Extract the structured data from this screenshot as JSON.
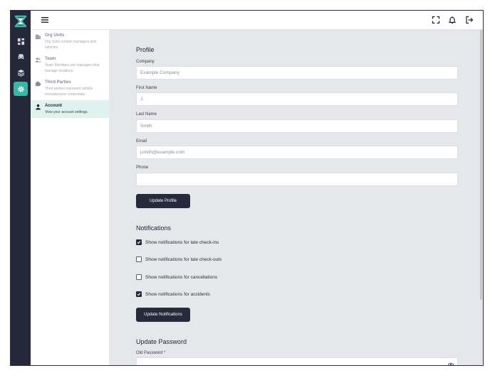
{
  "topbar": {
    "menu_icon": "hamburger-icon",
    "actions": [
      {
        "name": "fullscreen-icon"
      },
      {
        "name": "bell-icon"
      },
      {
        "name": "logout-icon"
      }
    ]
  },
  "rail": {
    "logo_icon": "app-logo-icon",
    "items": [
      {
        "name": "dashboard-icon",
        "active": false
      },
      {
        "name": "car-icon",
        "active": false
      },
      {
        "name": "layers-icon",
        "active": false
      },
      {
        "name": "gear-icon",
        "active": true
      }
    ]
  },
  "settings_nav": {
    "items": [
      {
        "title": "Org Units",
        "desc": "Org Units contain managers and vehicles.",
        "icon": "building-icon",
        "active": false
      },
      {
        "title": "Team",
        "desc": "Team Members are managers that manage locations.",
        "icon": "team-icon",
        "active": false
      },
      {
        "title": "Third Parties",
        "desc": "Third parties represent vehicle manufactures credentials.",
        "icon": "puzzle-icon",
        "active": false
      },
      {
        "title": "Account",
        "desc": "View your account settings.",
        "icon": "person-icon",
        "active": true
      }
    ]
  },
  "profile": {
    "title": "Profile",
    "company_label": "Company",
    "company_placeholder": "Example Company",
    "first_name_label": "First Name",
    "first_name_placeholder": "J.",
    "last_name_label": "Last Name",
    "last_name_placeholder": "Smith",
    "email_label": "Email",
    "email_placeholder": "jsmith@example.com",
    "phone_label": "Phone",
    "phone_placeholder": "",
    "update_button": "Update Profile"
  },
  "notifications": {
    "title": "Notifications",
    "options": [
      {
        "label": "Show notifications for late check-ins",
        "checked": true
      },
      {
        "label": "Show notifications for late check-outs",
        "checked": false
      },
      {
        "label": "Show notifications for cancellations",
        "checked": false
      },
      {
        "label": "Show notifications for accidents",
        "checked": true
      }
    ],
    "update_button": "Update Notifications"
  },
  "password": {
    "title": "Update Password",
    "old_password_label": "Old Password *",
    "eye_icon": "eye-icon"
  },
  "colors": {
    "rail_bg": "#242838",
    "accent": "#38b6a8",
    "active_nav_bg": "#dff2f0",
    "button_bg": "#272a3a",
    "main_bg": "#e6e7ea"
  }
}
